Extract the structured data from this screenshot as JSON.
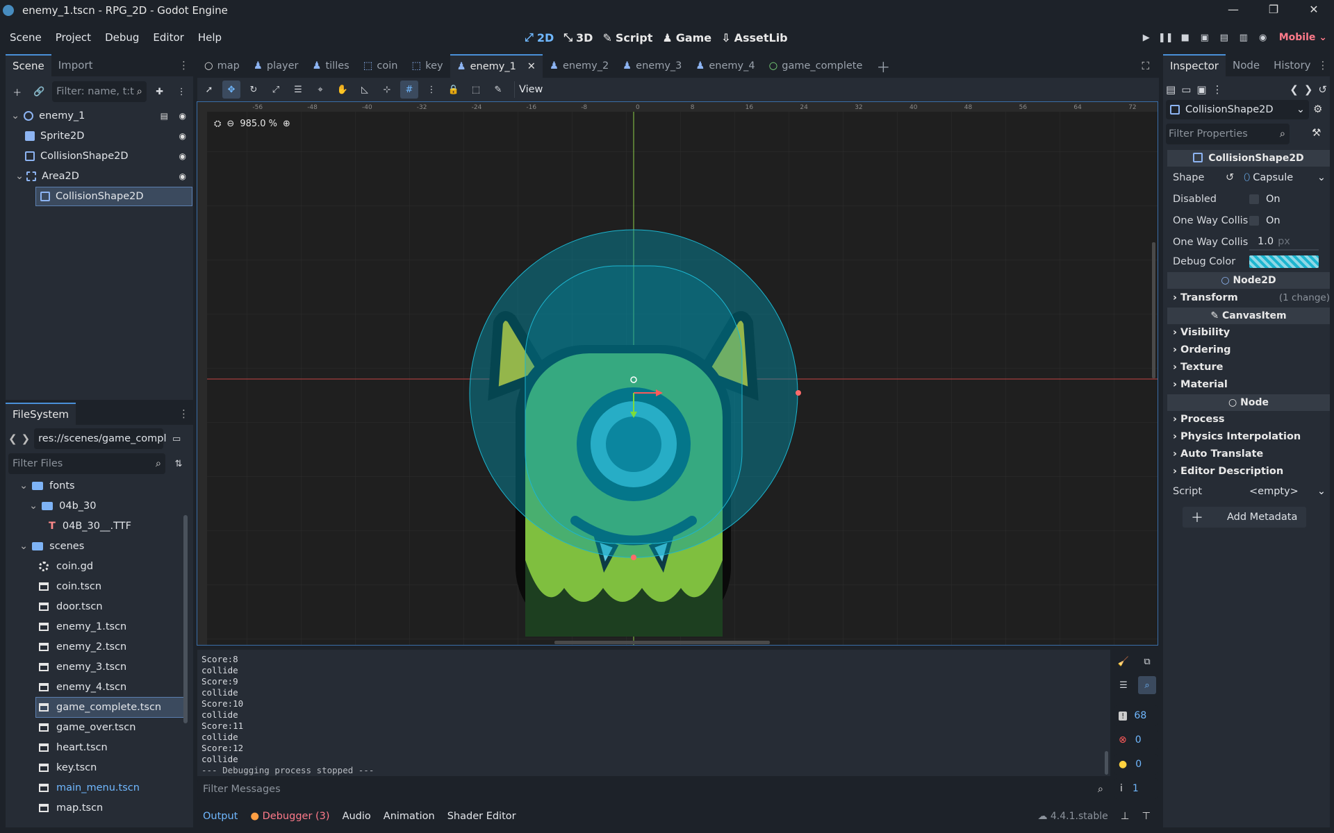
{
  "window": {
    "title": "enemy_1.tscn - RPG_2D - Godot Engine"
  },
  "menu": [
    "Scene",
    "Project",
    "Debug",
    "Editor",
    "Help"
  ],
  "main_screens": [
    "2D",
    "3D",
    "Script",
    "Game",
    "AssetLib"
  ],
  "renderer": "Mobile",
  "scene_dock": {
    "tabs": [
      "Scene",
      "Import"
    ],
    "filter_placeholder": "Filter: name, t:t",
    "nodes": [
      {
        "name": "enemy_1",
        "icon": "characterbody-icon"
      },
      {
        "name": "Sprite2D",
        "icon": "sprite-icon"
      },
      {
        "name": "CollisionShape2D",
        "icon": "collisionshape-icon"
      },
      {
        "name": "Area2D",
        "icon": "area-icon"
      },
      {
        "name": "CollisionShape2D",
        "icon": "collisionshape-icon"
      }
    ]
  },
  "filesystem": {
    "tab": "FileSystem",
    "path": "res://scenes/game_compl",
    "filter_placeholder": "Filter Files",
    "items": [
      "fonts",
      "04b_30",
      "04B_30__.TTF",
      "scenes",
      "coin.gd",
      "coin.tscn",
      "door.tscn",
      "enemy_1.tscn",
      "enemy_2.tscn",
      "enemy_3.tscn",
      "enemy_4.tscn",
      "game_complete.tscn",
      "game_over.tscn",
      "heart.tscn",
      "key.tscn",
      "main_menu.tscn",
      "map.tscn"
    ]
  },
  "doc_tabs": [
    "map",
    "player",
    "tilles",
    "coin",
    "key",
    "enemy_1",
    "enemy_2",
    "enemy_3",
    "enemy_4",
    "game_complete"
  ],
  "viewport": {
    "view_menu": "View",
    "zoom": "985.0 %",
    "ruler_labels": [
      "-56",
      "-48",
      "-40",
      "-32",
      "-24",
      "-16",
      "-8",
      "0",
      "8",
      "16",
      "24",
      "32",
      "40",
      "48",
      "56",
      "64",
      "72"
    ]
  },
  "output": {
    "lines": [
      "Score:8",
      "collide",
      "Score:9",
      "collide",
      "Score:10",
      "collide",
      "Score:11",
      "collide",
      "Score:12",
      "collide",
      "--- Debugging process stopped ---"
    ],
    "filter_placeholder": "Filter Messages",
    "counts": {
      "messages": "68",
      "errors": "0",
      "warnings": "0",
      "info": "1"
    }
  },
  "bottom_tabs": [
    "Output",
    "Debugger (3)",
    "Audio",
    "Animation",
    "Shader Editor"
  ],
  "version": "4.4.1.stable",
  "inspector": {
    "tabs": [
      "Inspector",
      "Node",
      "History"
    ],
    "object": "CollisionShape2D",
    "filter_placeholder": "Filter Properties",
    "section_title": "CollisionShape2D",
    "props": {
      "shape_label": "Shape",
      "shape_value": "Capsule",
      "disabled_label": "Disabled",
      "disabled_value": "On",
      "owc_label": "One Way Collis",
      "owc_value": "On",
      "owcm_label": "One Way Collis",
      "owcm_value": "1.0",
      "owcm_unit": "px",
      "debug_color_label": "Debug Color"
    },
    "node2d": "Node2D",
    "transform": "Transform",
    "transform_note": "(1 change)",
    "canvasitem": "CanvasItem",
    "canvas_groups": [
      "Visibility",
      "Ordering",
      "Texture",
      "Material"
    ],
    "node": "Node",
    "node_groups": [
      "Process",
      "Physics Interpolation",
      "Auto Translate",
      "Editor Description"
    ],
    "script_label": "Script",
    "script_value": "<empty>",
    "add_metadata": "Add Metadata"
  },
  "colors": {
    "accent": "#70b8ff",
    "bg": "#1d2229",
    "panel": "#262c35"
  }
}
